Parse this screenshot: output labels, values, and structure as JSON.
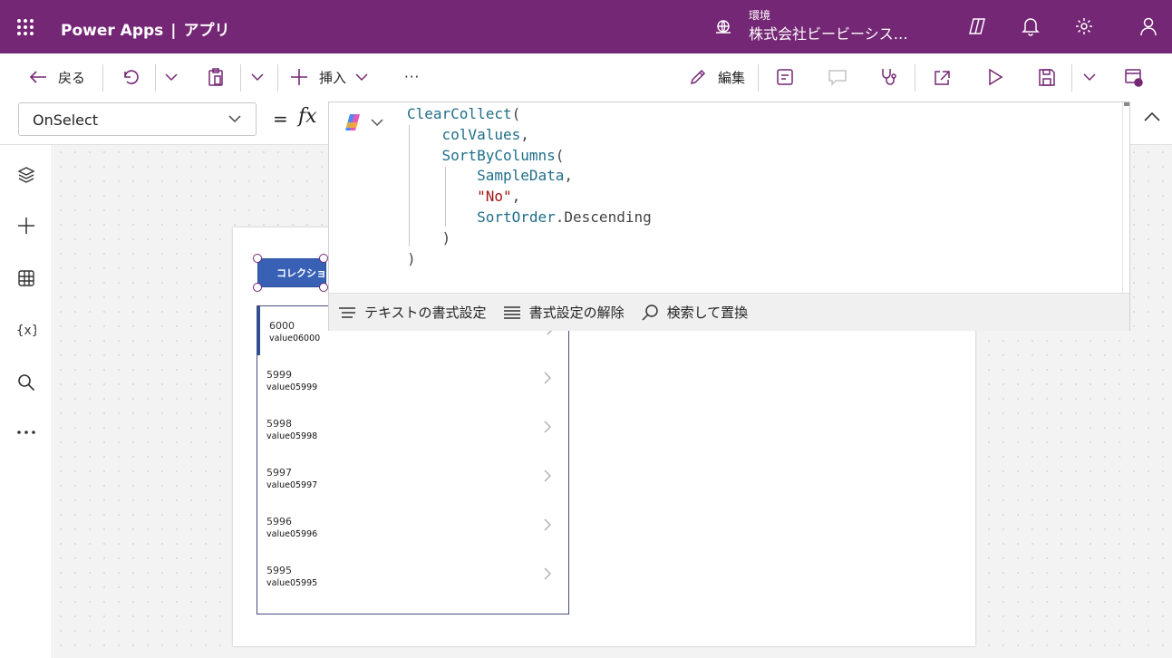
{
  "header": {
    "app_name": "Power Apps",
    "separator": "|",
    "section": "アプリ",
    "env_label": "環境",
    "env_name": "株式会社ビービーシス…"
  },
  "toolbar": {
    "back_label": "戻る",
    "insert_label": "挿入",
    "more_label": "···",
    "edit_label": "編集"
  },
  "formula": {
    "property": "OnSelect",
    "equals": "=",
    "fx": "fx"
  },
  "code": {
    "l1_fn": "ClearCollect",
    "l1_p": "(",
    "l2_var": "colValues",
    "l2_c": ",",
    "l3_fn": "SortByColumns",
    "l3_p": "(",
    "l4_var": "SampleData",
    "l4_c": ",",
    "l5_str": "\"No\"",
    "l5_c": ",",
    "l6_enum": "SortOrder",
    "l6_rest": ".Descending",
    "l7": ")",
    "l8": ")"
  },
  "editbar": {
    "format_text": "テキストの書式設定",
    "remove_format": "書式設定の解除",
    "find_replace": "検索して置換"
  },
  "canvas": {
    "button_label": "コレクション",
    "gallery": [
      {
        "title": "6000",
        "subtitle": "value06000"
      },
      {
        "title": "5999",
        "subtitle": "value05999"
      },
      {
        "title": "5998",
        "subtitle": "value05998"
      },
      {
        "title": "5997",
        "subtitle": "value05997"
      },
      {
        "title": "5996",
        "subtitle": "value05996"
      },
      {
        "title": "5995",
        "subtitle": "value05995"
      }
    ]
  },
  "colors": {
    "brand": "#742774",
    "button": "#3861b6"
  }
}
